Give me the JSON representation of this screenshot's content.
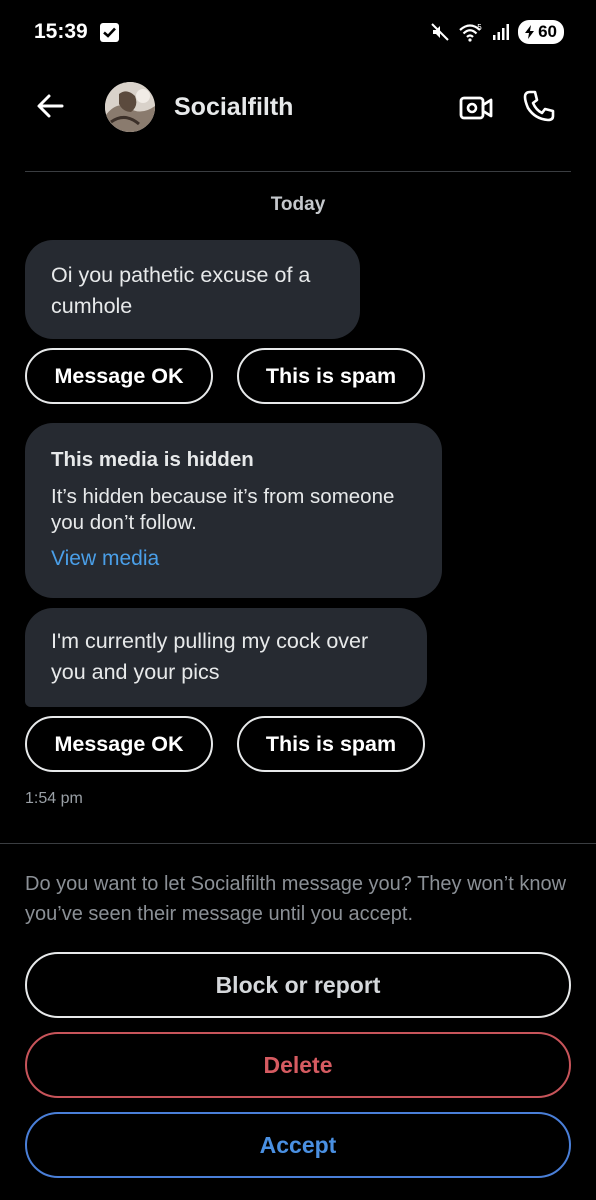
{
  "status_bar": {
    "time": "15:39",
    "battery": "60"
  },
  "header": {
    "contact_name": "Socialfilth",
    "icons": [
      "back-arrow-icon",
      "avatar",
      "video-call-icon",
      "phone-icon"
    ]
  },
  "conversation": {
    "date_label": "Today",
    "messages": [
      {
        "text": "Oi you pathetic excuse of a cumhole"
      },
      {
        "media_title": "This media is hidden",
        "media_desc": "It’s hidden because it’s from someone you don’t follow.",
        "media_link": "View media"
      },
      {
        "text": "I'm currently pulling my cock over you and your pics"
      }
    ],
    "message_ok_label": "Message OK",
    "spam_label": "This is spam",
    "timestamp": "1:54 pm"
  },
  "request": {
    "prompt": "Do you want to let Socialfilth message you? They won’t know you’ve seen their message until you accept.",
    "block_label": "Block or report",
    "delete_label": "Delete",
    "accept_label": "Accept"
  },
  "colors": {
    "background": "#000000",
    "bubble": "#262a31",
    "link": "#4a9fe8",
    "delete": "#d65b61",
    "accept": "#4a90e2"
  }
}
